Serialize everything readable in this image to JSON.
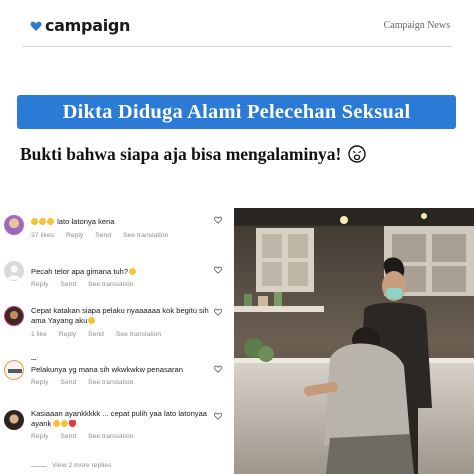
{
  "header": {
    "brand": "campaign",
    "source": "Campaign News",
    "heart_color": "#2b7bd6"
  },
  "headline": {
    "text": "Dikta Diduga Alami Pelecehan Seksual",
    "bg_color": "#2b7bd6"
  },
  "subline": {
    "text": "Bukti bahwa siapa aja bisa mengalaminya!",
    "emoji": "weary-face-emoji"
  },
  "comments": [
    {
      "text": "lato latonya kena",
      "leading_emojis": 3,
      "meta": [
        "37 likes",
        "Reply",
        "Send",
        "See translation"
      ]
    },
    {
      "text": "Pecah telor apa gimana tuh?",
      "trailing_emojis": 1,
      "meta": [
        "Reply",
        "Send",
        "See translation"
      ]
    },
    {
      "text": "Cepat katakan siapa pelaku nyaaaaaa kok begitu sih ama Yayang aku",
      "trailing_emojis": 1,
      "meta": [
        "1 like",
        "Reply",
        "Send",
        "See translation"
      ]
    },
    {
      "partial_name": "...",
      "text": "Pelakunya yg mana sih wkwkwkw penasaran",
      "meta": [
        "Reply",
        "Send",
        "See translation"
      ]
    },
    {
      "text": "Kasiaaan ayankkkkk ... cepat pulih yaa lato latonyaa ayank",
      "trailing_emojis": 3,
      "meta": [
        "Reply",
        "Send",
        "See translation"
      ]
    }
  ],
  "view_more": "View 2 more replies",
  "photo": {
    "description_icon": "cafe-photo"
  }
}
